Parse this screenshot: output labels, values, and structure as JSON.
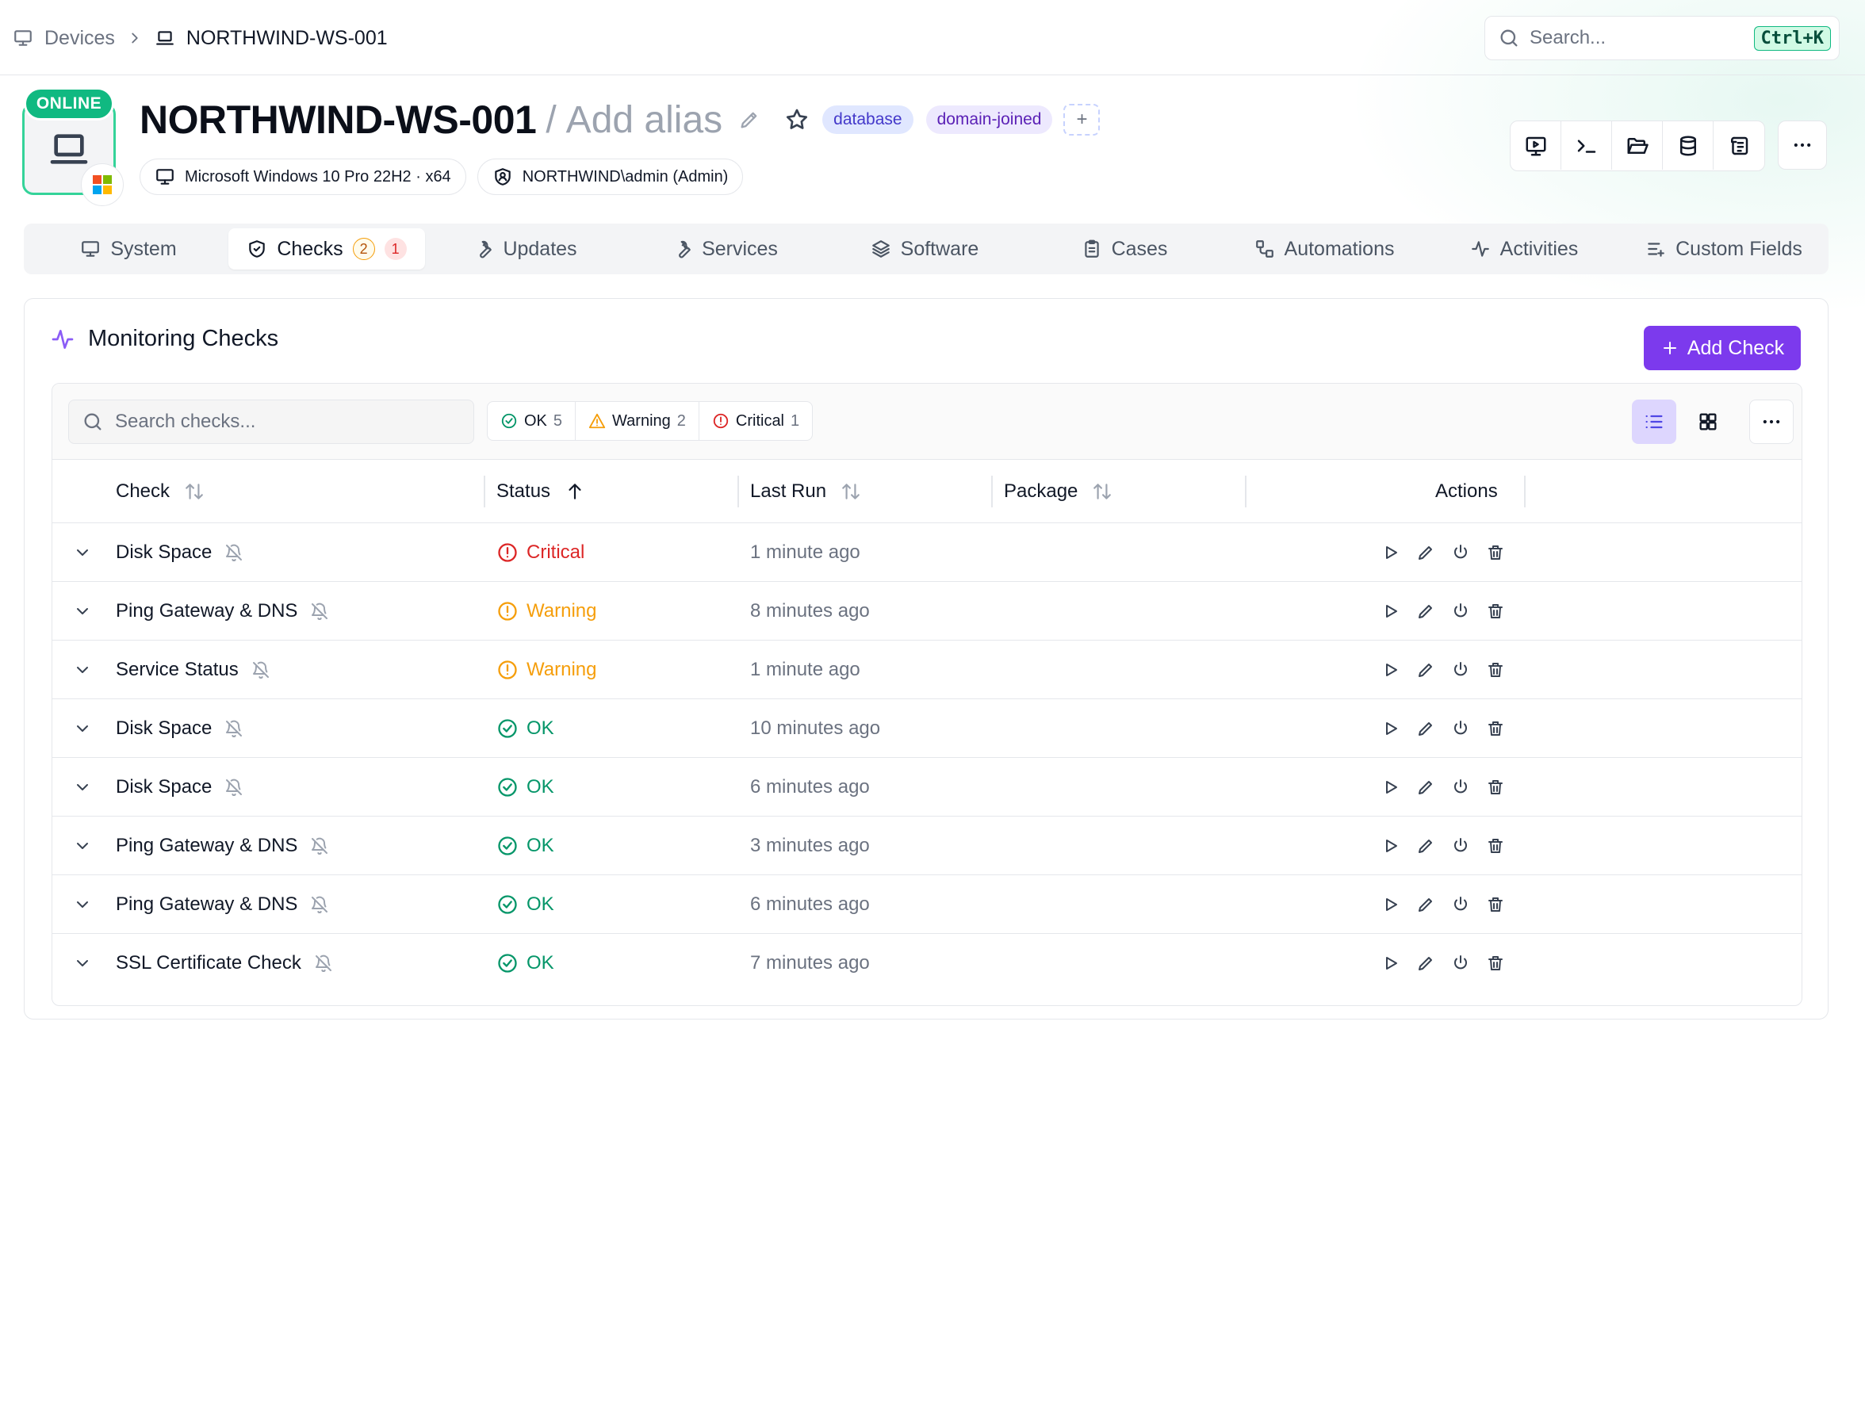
{
  "breadcrumb": {
    "root": "Devices",
    "current": "NORTHWIND-WS-001"
  },
  "global_search": {
    "placeholder": "Search...",
    "shortcut": "Ctrl+K"
  },
  "device": {
    "status": "ONLINE",
    "hostname": "NORTHWIND-WS-001",
    "alias_prefix": "/",
    "alias_placeholder": "Add alias",
    "tags": [
      "database",
      "domain-joined"
    ],
    "add_tag": "+",
    "os": "Microsoft Windows 10 Pro 22H2 · x64",
    "user": "NORTHWIND\\admin (Admin)"
  },
  "toolbar": {
    "icons": [
      "remote-desktop-icon",
      "terminal-icon",
      "file-browser-icon",
      "database-icon",
      "script-icon"
    ],
    "more_icon": "more-horizontal-icon"
  },
  "tabs": [
    {
      "label": "System",
      "icon": "monitor-icon"
    },
    {
      "label": "Checks",
      "icon": "shield-check-icon",
      "active": true,
      "warning_count": "2",
      "critical_count": "1"
    },
    {
      "label": "Updates",
      "icon": "wrench-icon"
    },
    {
      "label": "Services",
      "icon": "wrench-icon"
    },
    {
      "label": "Software",
      "icon": "layers-icon"
    },
    {
      "label": "Cases",
      "icon": "clipboard-icon"
    },
    {
      "label": "Automations",
      "icon": "workflow-icon"
    },
    {
      "label": "Activities",
      "icon": "activity-icon"
    },
    {
      "label": "Custom Fields",
      "icon": "list-plus-icon"
    }
  ],
  "checks_panel": {
    "title": "Monitoring Checks",
    "add_button": "Add Check",
    "search_placeholder": "Search checks...",
    "filters": [
      {
        "label": "OK",
        "count": "5",
        "color": "#059669"
      },
      {
        "label": "Warning",
        "count": "2",
        "color": "#f59e0b"
      },
      {
        "label": "Critical",
        "count": "1",
        "color": "#dc2626"
      }
    ],
    "view_mode": "list",
    "columns": {
      "check": "Check",
      "status": "Status",
      "last_run": "Last Run",
      "package": "Package",
      "actions": "Actions"
    },
    "sort": {
      "column": "Status",
      "direction": "ascending"
    },
    "rows": [
      {
        "name": "Disk Space",
        "status": "Critical",
        "last_run": "1 minute ago",
        "package": ""
      },
      {
        "name": "Ping Gateway & DNS",
        "status": "Warning",
        "last_run": "8 minutes ago",
        "package": ""
      },
      {
        "name": "Service Status",
        "status": "Warning",
        "last_run": "1 minute ago",
        "package": ""
      },
      {
        "name": "Disk Space",
        "status": "OK",
        "last_run": "10 minutes ago",
        "package": ""
      },
      {
        "name": "Disk Space",
        "status": "OK",
        "last_run": "6 minutes ago",
        "package": ""
      },
      {
        "name": "Ping Gateway & DNS",
        "status": "OK",
        "last_run": "3 minutes ago",
        "package": ""
      },
      {
        "name": "Ping Gateway & DNS",
        "status": "OK",
        "last_run": "6 minutes ago",
        "package": ""
      },
      {
        "name": "SSL Certificate Check",
        "status": "OK",
        "last_run": "7 minutes ago",
        "package": ""
      }
    ]
  },
  "colors": {
    "accent": "#7c3aed",
    "online": "#10b981",
    "ok": "#059669",
    "warning": "#f59e0b",
    "critical": "#dc2626"
  }
}
